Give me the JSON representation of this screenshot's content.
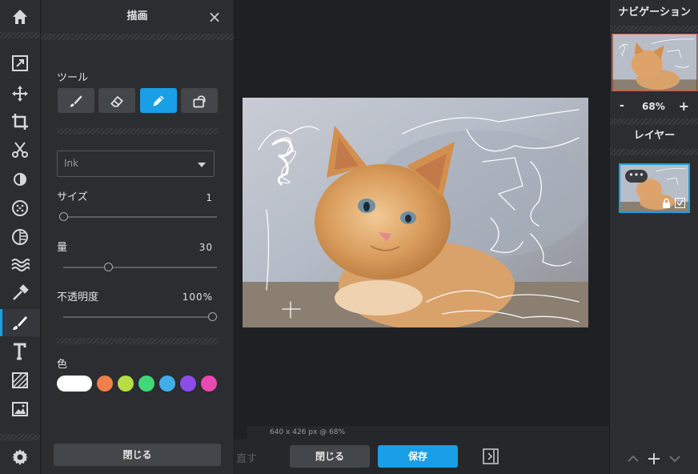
{
  "panel": {
    "title": "描画",
    "close_icon": "×",
    "tools_label": "ツール",
    "brush_type": "Ink",
    "size_label": "サイズ",
    "size_value": "1",
    "size_fraction": 0.0,
    "amount_label": "量",
    "amount_value": "30",
    "amount_fraction": 0.3,
    "opacity_label": "不透明度",
    "opacity_value": "100%",
    "opacity_fraction": 1.0,
    "color_label": "色",
    "colors": [
      "#ffffff",
      "#f07f4a",
      "#b8dd45",
      "#3fd97a",
      "#42aee8",
      "#8a4de8",
      "#e84ab2"
    ],
    "close_button": "閉じる"
  },
  "canvas": {
    "status": "640 x 426 px @ 68%"
  },
  "bottom": {
    "undo_label": "直す",
    "close_button": "閉じる",
    "save_button": "保存"
  },
  "navigator": {
    "title": "ナビゲーション",
    "zoom_minus": "-",
    "zoom_value": "68%",
    "zoom_plus": "+"
  },
  "layers": {
    "title": "レイヤー",
    "more_label": "•••"
  },
  "colors": {
    "accent": "#1a9ee6",
    "panel_bg": "#2b2d31",
    "canvas_bg": "#1f2023"
  }
}
